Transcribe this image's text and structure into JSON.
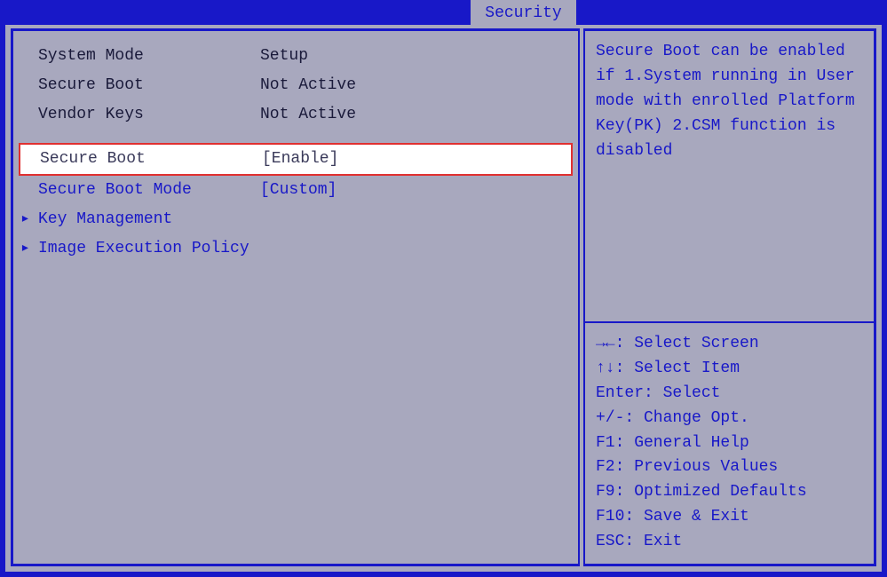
{
  "tab": {
    "label": "Security"
  },
  "info": {
    "system_mode": {
      "label": "System Mode",
      "value": "Setup"
    },
    "secure_boot": {
      "label": "Secure Boot",
      "value": "Not Active"
    },
    "vendor_keys": {
      "label": "Vendor Keys",
      "value": "Not Active"
    }
  },
  "menu": {
    "secure_boot_toggle": {
      "label": "Secure Boot",
      "value": "[Enable]"
    },
    "secure_boot_mode": {
      "label": "Secure Boot Mode",
      "value": "[Custom]"
    },
    "key_management": {
      "label": "Key Management"
    },
    "image_exec_policy": {
      "label": "Image Execution Policy"
    }
  },
  "help": {
    "text": "Secure Boot can be enabled if 1.System running in User mode with enrolled Platform Key(PK) 2.CSM function is disabled"
  },
  "nav": {
    "select_screen": "→←: Select Screen",
    "select_item": "↑↓: Select Item",
    "enter": "Enter: Select",
    "change_opt": "+/-: Change Opt.",
    "general_help": "F1: General Help",
    "previous_values": "F2: Previous Values",
    "optimized_defaults": "F9: Optimized Defaults",
    "save_exit": "F10: Save & Exit",
    "esc": "ESC: Exit"
  },
  "glyphs": {
    "triangle": "▸"
  }
}
